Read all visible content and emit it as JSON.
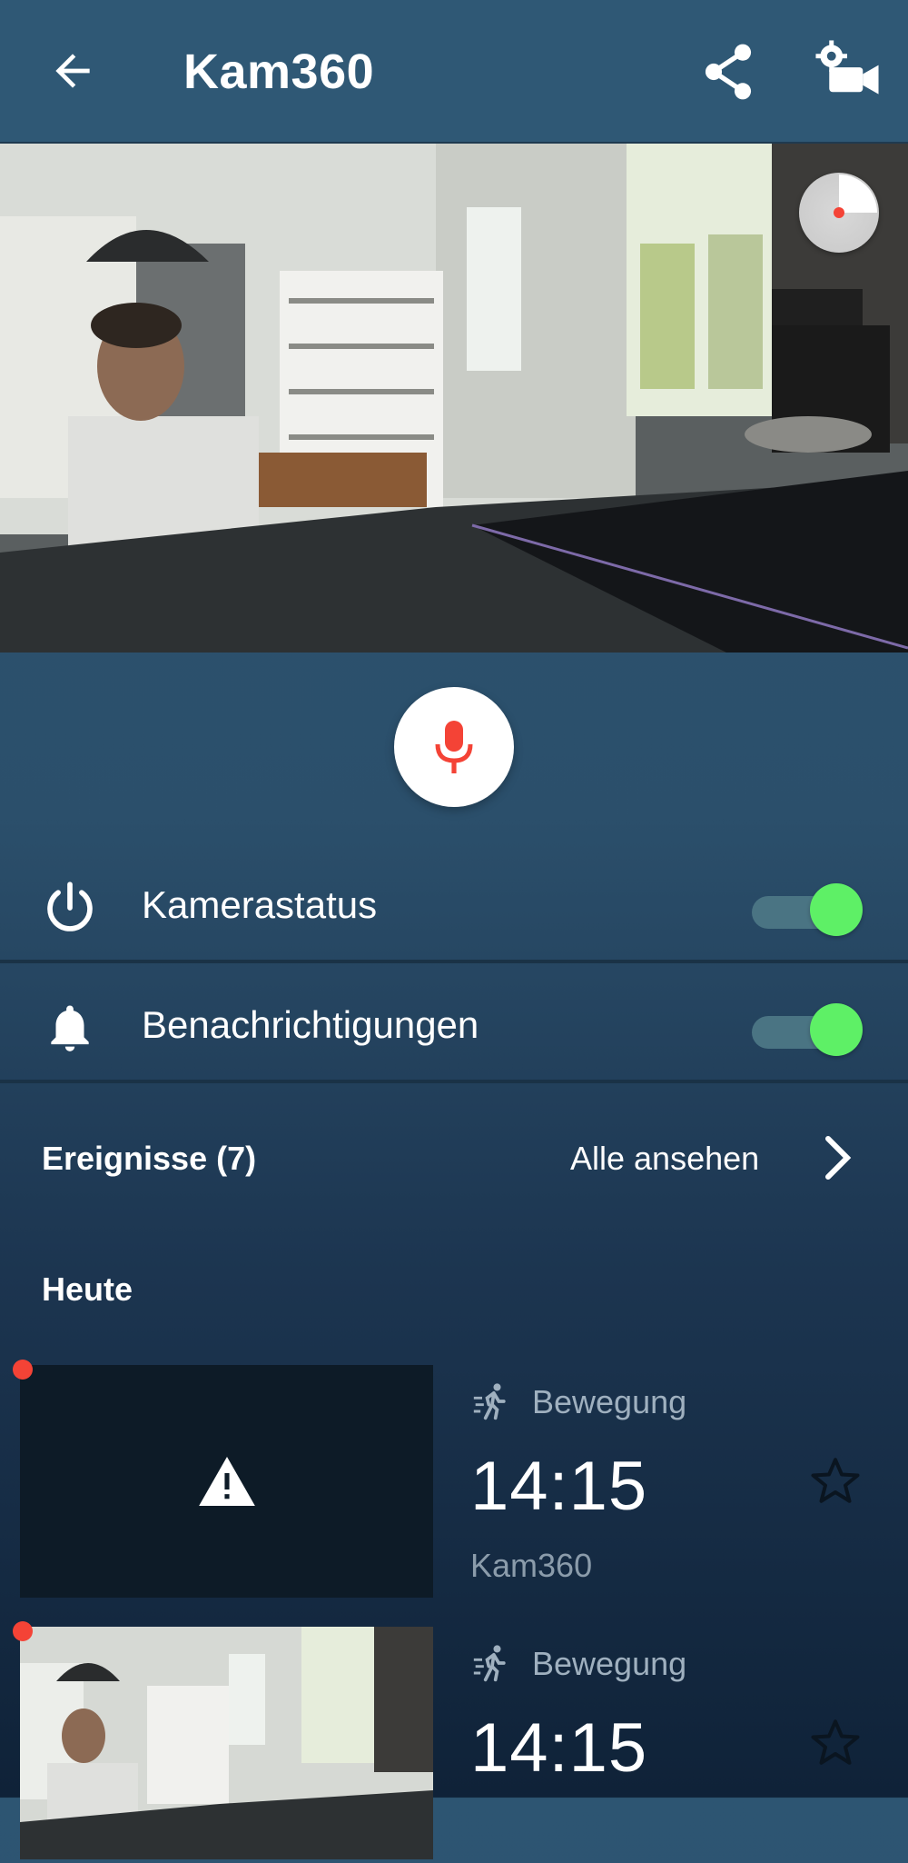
{
  "header": {
    "title": "Kam360",
    "icons": {
      "back": "arrow-left-icon",
      "share": "share-icon",
      "settings": "camera-settings-icon"
    }
  },
  "live_view": {
    "ptz_indicator": "ptz-position-icon"
  },
  "mic": {
    "icon": "microphone-icon",
    "color": "#f44336"
  },
  "settings": [
    {
      "icon": "power-icon",
      "label": "Kamerastatus",
      "enabled": true
    },
    {
      "icon": "bell-icon",
      "label": "Benachrichtigungen",
      "enabled": true
    }
  ],
  "events": {
    "title": "Ereignisse (7)",
    "see_all": "Alle ansehen",
    "groups": [
      {
        "label": "Heute",
        "items": [
          {
            "type": "Bewegung",
            "time": "14:15",
            "camera": "Kam360",
            "thumbnail": "warning-icon",
            "unread": true,
            "starred": false
          },
          {
            "type": "Bewegung",
            "time": "14:15",
            "camera": "",
            "thumbnail": "snapshot",
            "unread": true,
            "starred": false
          }
        ]
      }
    ]
  },
  "colors": {
    "accent_green": "#5ef066",
    "alert_red": "#f44336",
    "header_bg": "#2f5875"
  }
}
